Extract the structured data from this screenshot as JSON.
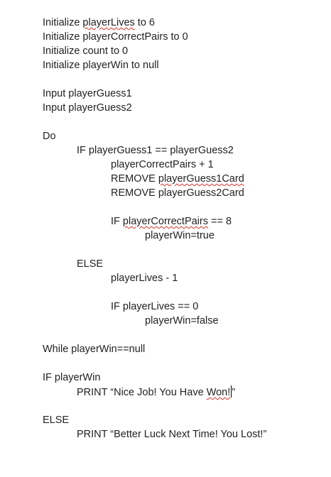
{
  "lines": {
    "init_lives_pre": "Initialize ",
    "init_lives_var": "playerLives",
    "init_lives_post": " to 6",
    "init_pairs": "Initialize playerCorrectPairs to 0",
    "init_count": "Initialize count to 0",
    "init_win": "Initialize playerWin to null",
    "input1": "Input playerGuess1",
    "input2": "Input playerGuess2",
    "do": "Do",
    "if_guess": "IF playerGuess1 == playerGuess2",
    "pairs_inc": "playerCorrectPairs + 1",
    "remove1_pre": "REMOVE ",
    "remove1_var": "playerGuess1Card",
    "remove2": "REMOVE playerGuess2Card",
    "if_pairs_pre": "IF ",
    "if_pairs_var": "playerCorrectPairs",
    "if_pairs_post": " == 8",
    "win_true": "playerWin=true",
    "else1": "ELSE",
    "lives_dec": "playerLives - 1",
    "if_lives": "IF playerLives == 0",
    "win_false": "playerWin=false",
    "while": "While playerWin==null",
    "if_win": "IF playerWin",
    "print_win_pre": "PRINT “Nice Job! You Have ",
    "print_win_word": "Won!",
    "print_win_post": "”",
    "else2": "ELSE",
    "print_lose": "PRINT “Better Luck Next Time! You Lost!”"
  }
}
